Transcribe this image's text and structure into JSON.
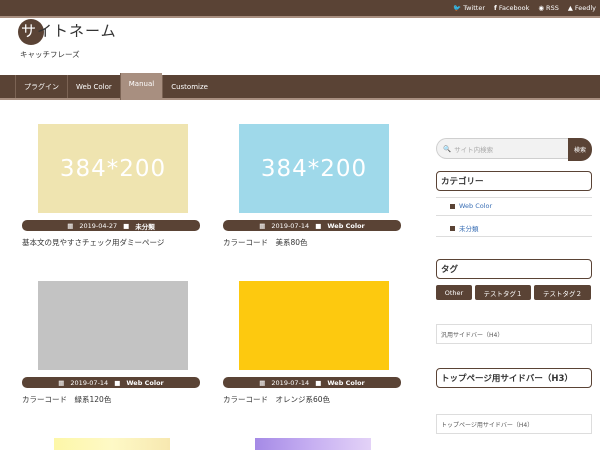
{
  "social": [
    {
      "icon": "twitter-icon",
      "glyph": "🐦",
      "label": "Twitter"
    },
    {
      "icon": "facebook-icon",
      "glyph": "f",
      "label": "Facebook"
    },
    {
      "icon": "rss-icon",
      "glyph": "◉",
      "label": "RSS"
    },
    {
      "icon": "feedly-icon",
      "glyph": "▲",
      "label": "Feedly"
    }
  ],
  "header": {
    "site_name_first": "サ",
    "site_name_rest": "イトネーム",
    "tagline": "キャッチフレーズ"
  },
  "nav": [
    "プラグイン",
    "Web Color",
    "Manual",
    "Customize"
  ],
  "posts": [
    {
      "thumb_text": "384*200",
      "thumb_color": "#efe4b0",
      "date": "2019-04-27",
      "category": "未分類",
      "title": "基本文の見やすさチェック用ダミーページ"
    },
    {
      "thumb_text": "384*200",
      "thumb_color": "#9fd9ea",
      "date": "2019-07-14",
      "category": "Web Color",
      "title": "カラーコード　美系80色"
    },
    {
      "thumb_text": "",
      "thumb_color": "#c3c3c3",
      "date": "2019-07-14",
      "category": "Web Color",
      "title": "カラーコード　緑系120色"
    },
    {
      "thumb_text": "",
      "thumb_color": "#fdc90f",
      "date": "2019-07-14",
      "category": "Web Color",
      "title": "カラーコード　オレンジ系60色"
    }
  ],
  "sidebar": {
    "search_placeholder": "サイト内検索",
    "search_button": "検索",
    "categories_title": "カテゴリー",
    "categories": [
      "Web Color",
      "未分類"
    ],
    "tags_title": "タグ",
    "tags": [
      "Other",
      "テストタグ１",
      "テストタグ２"
    ],
    "widget_general": "汎用サイドバー（H4）",
    "top_sidebar_title": "トップページ用サイドバー（H3）",
    "top_sidebar_h4": "トップページ用サイドバー（H4）"
  },
  "colors": {
    "brand": "#5a4335",
    "accent": "#a88f80",
    "link": "#3a6fb5"
  }
}
